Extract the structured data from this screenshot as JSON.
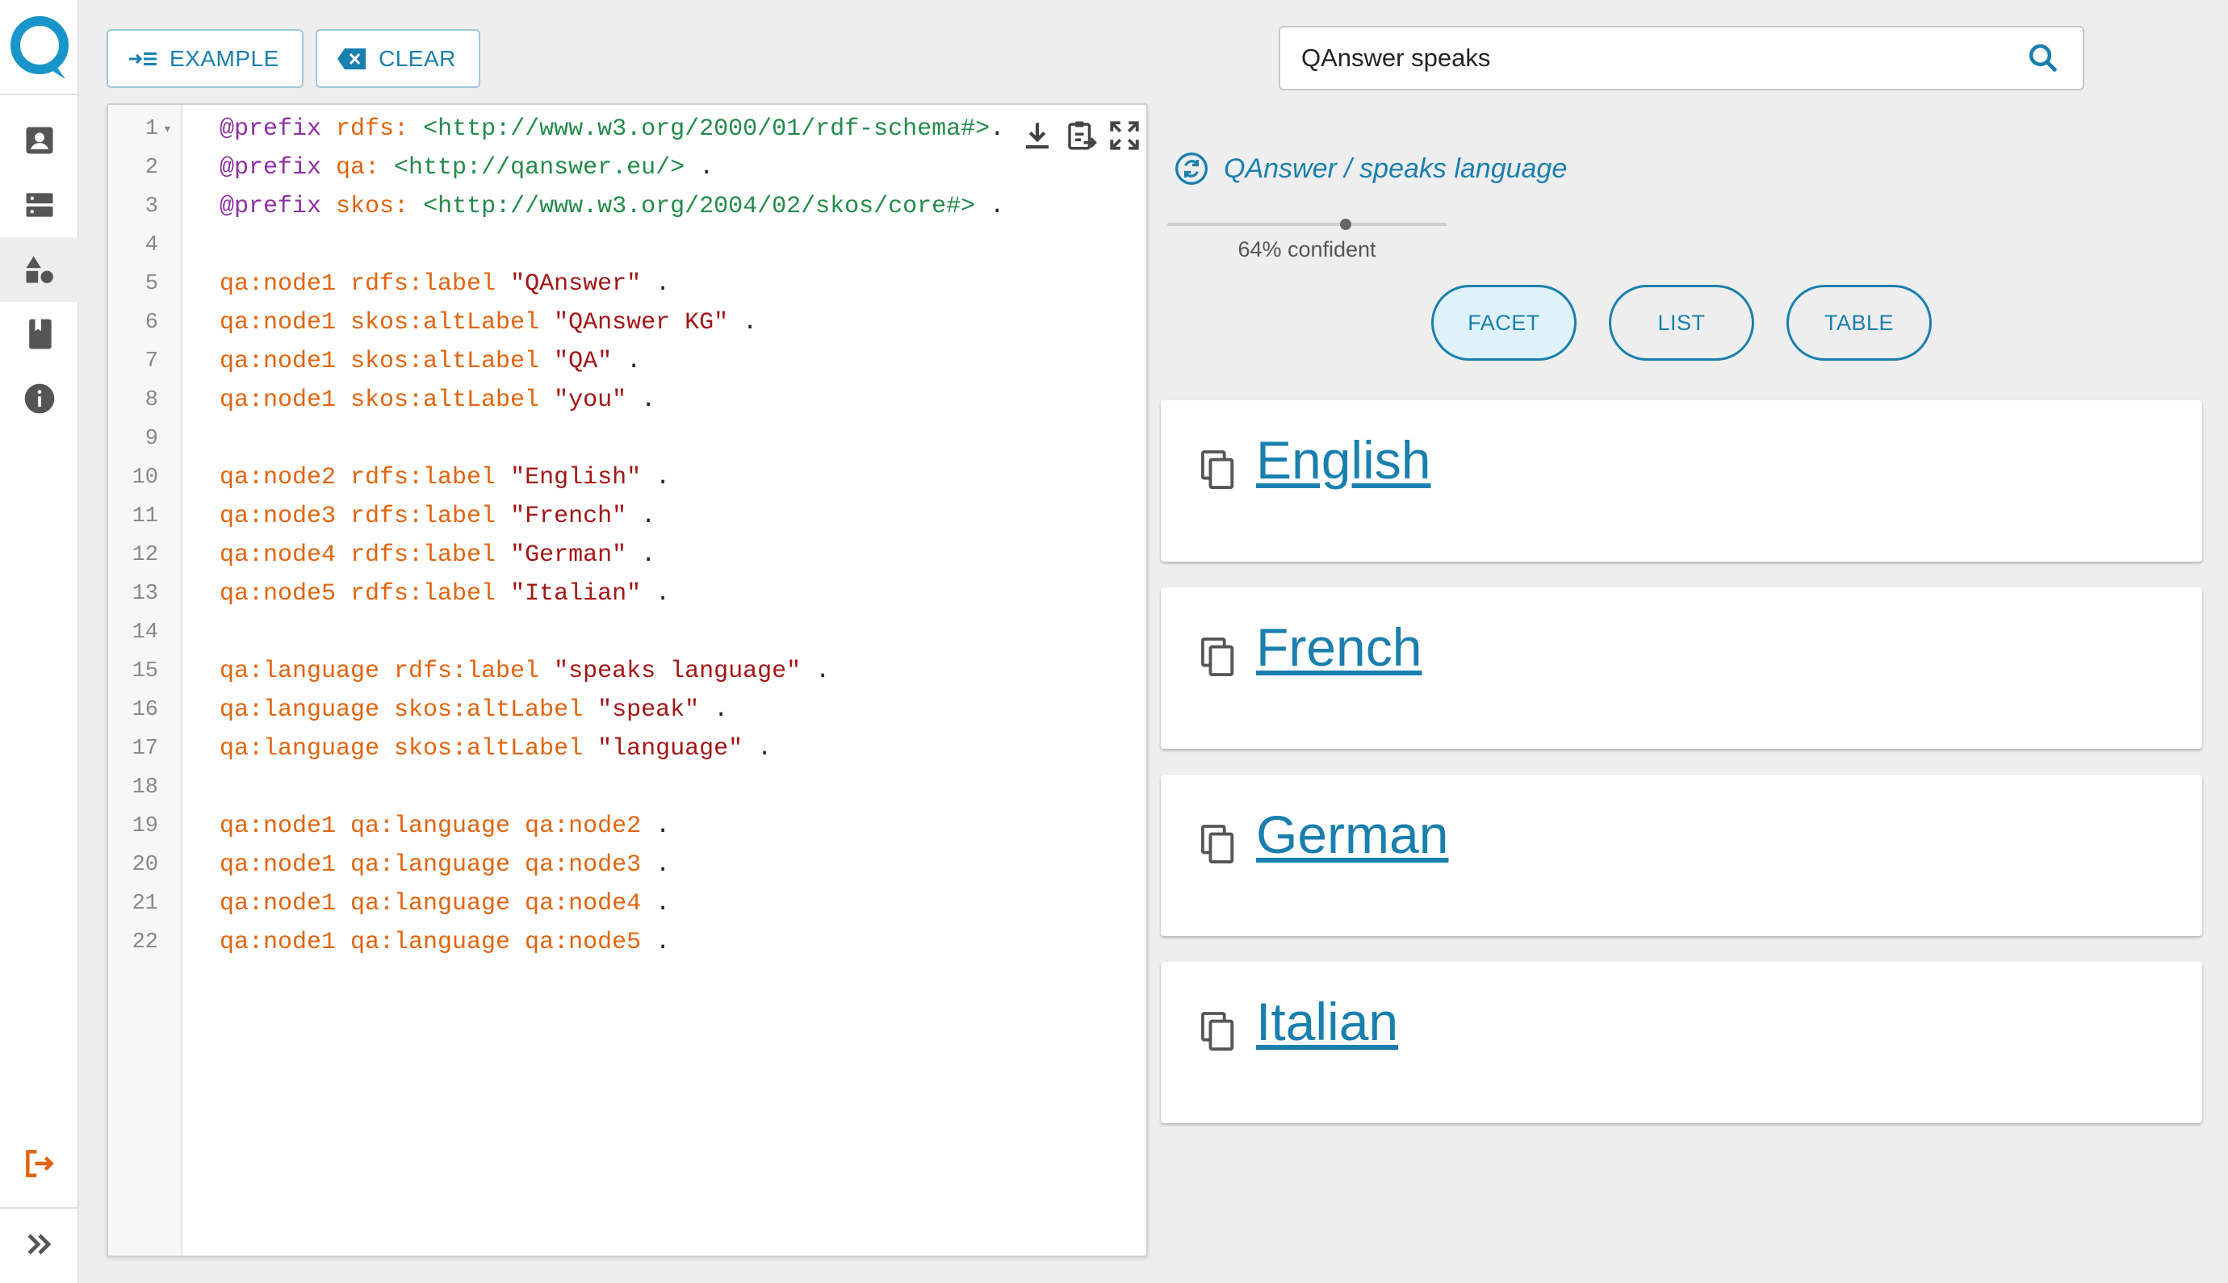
{
  "toolbar": {
    "example_label": "EXAMPLE",
    "clear_label": "CLEAR"
  },
  "search": {
    "value": "QAnswer speaks"
  },
  "editor": {
    "lines": [
      [
        [
          "kw",
          "@prefix "
        ],
        [
          "pfx",
          "rdfs: "
        ],
        [
          "uri",
          "<http://www.w3.org/2000/01/rdf-schema#>"
        ],
        [
          "",
          "."
        ]
      ],
      [
        [
          "kw",
          "@prefix "
        ],
        [
          "pfx",
          "qa: "
        ],
        [
          "uri",
          "<http://qanswer.eu/>"
        ],
        [
          "",
          " ."
        ]
      ],
      [
        [
          "kw",
          "@prefix "
        ],
        [
          "pfx",
          "skos: "
        ],
        [
          "uri",
          "<http://www.w3.org/2004/02/skos/core#>"
        ],
        [
          "",
          " ."
        ]
      ],
      [],
      [
        [
          "pfx",
          "qa:node1 rdfs:label "
        ],
        [
          "str",
          "\"QAnswer\""
        ],
        [
          "",
          " ."
        ]
      ],
      [
        [
          "pfx",
          "qa:node1 skos:altLabel "
        ],
        [
          "str",
          "\"QAnswer KG\""
        ],
        [
          "",
          " ."
        ]
      ],
      [
        [
          "pfx",
          "qa:node1 skos:altLabel "
        ],
        [
          "str",
          "\"QA\""
        ],
        [
          "",
          " ."
        ]
      ],
      [
        [
          "pfx",
          "qa:node1 skos:altLabel "
        ],
        [
          "str",
          "\"you\""
        ],
        [
          "",
          " ."
        ]
      ],
      [],
      [
        [
          "pfx",
          "qa:node2 rdfs:label "
        ],
        [
          "str",
          "\"English\""
        ],
        [
          "",
          " ."
        ]
      ],
      [
        [
          "pfx",
          "qa:node3 rdfs:label "
        ],
        [
          "str",
          "\"French\""
        ],
        [
          "",
          " ."
        ]
      ],
      [
        [
          "pfx",
          "qa:node4 rdfs:label "
        ],
        [
          "str",
          "\"German\""
        ],
        [
          "",
          " ."
        ]
      ],
      [
        [
          "pfx",
          "qa:node5 rdfs:label "
        ],
        [
          "str",
          "\"Italian\""
        ],
        [
          "",
          " ."
        ]
      ],
      [],
      [
        [
          "pfx",
          "qa:language rdfs:label "
        ],
        [
          "str",
          "\"speaks language\""
        ],
        [
          "",
          " ."
        ]
      ],
      [
        [
          "pfx",
          "qa:language skos:altLabel "
        ],
        [
          "str",
          "\"speak\""
        ],
        [
          "",
          " ."
        ]
      ],
      [
        [
          "pfx",
          "qa:language skos:altLabel "
        ],
        [
          "str",
          "\"language\""
        ],
        [
          "",
          " ."
        ]
      ],
      [],
      [
        [
          "pfx",
          "qa:node1 qa:language qa:node2"
        ],
        [
          "",
          " ."
        ]
      ],
      [
        [
          "pfx",
          "qa:node1 qa:language qa:node3"
        ],
        [
          "",
          " ."
        ]
      ],
      [
        [
          "pfx",
          "qa:node1 qa:language qa:node4"
        ],
        [
          "",
          " ."
        ]
      ],
      [
        [
          "pfx",
          "qa:node1 qa:language qa:node5"
        ],
        [
          "",
          " ."
        ]
      ]
    ]
  },
  "answer": {
    "title": "QAnswer / speaks language",
    "confidence_value": 0.64,
    "confidence_label": "64% confident",
    "views": [
      "FACET",
      "LIST",
      "TABLE"
    ],
    "active_view": "FACET",
    "results": [
      "English",
      "French",
      "German",
      "Italian"
    ]
  },
  "colors": {
    "accent": "#1a7fae",
    "logout": "#e2640f",
    "keyword": "#8e2ea3",
    "prefix": "#e2640f",
    "uri": "#238a4a",
    "string": "#a31515"
  },
  "icons": {
    "sidebar": [
      "user-icon",
      "server-icon",
      "shapes-icon",
      "book-icon",
      "info-icon"
    ],
    "bottom": [
      "logout-icon",
      "expand-icon"
    ],
    "editor_tools": [
      "download-icon",
      "paste-icon",
      "fullscreen-icon"
    ]
  }
}
